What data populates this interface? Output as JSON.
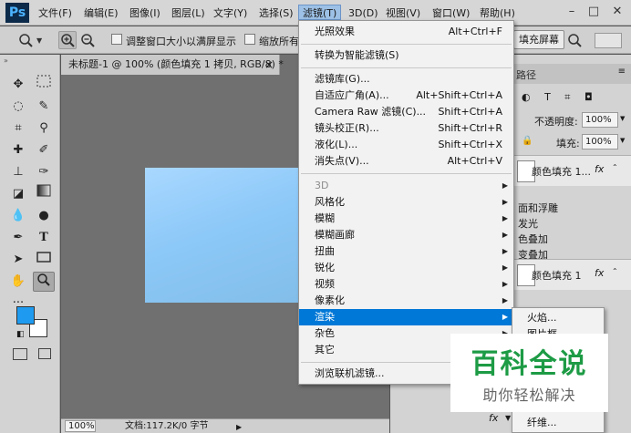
{
  "app": {
    "logo": "Ps",
    "menu": [
      "文件(F)",
      "编辑(E)",
      "图像(I)",
      "图层(L)",
      "文字(Y)",
      "选择(S)",
      "滤镜(T)",
      "3D(D)",
      "视图(V)",
      "窗口(W)",
      "帮助(H)"
    ],
    "active_menu": "滤镜(T)"
  },
  "options_bar": {
    "checkbox1_label": "调整窗口大小以满屏显示",
    "checkbox2_label": "缩放所有",
    "fill_screen_btn": "填充屏幕"
  },
  "document": {
    "tab_title": "未标题-1 @ 100% (颜色填充 1 拷贝, RGB/8) *",
    "tab_close": "×",
    "zoom": "100%",
    "doc_info": "文档:117.2K/0 字节"
  },
  "colors": {
    "foreground": "#1e9bf0",
    "background": "#ffffff",
    "highlight": "#0078d7"
  },
  "filter_menu": {
    "items": [
      {
        "label": "光照效果",
        "shortcut": "Alt+Ctrl+F"
      },
      {
        "label": "转换为智能滤镜(S)",
        "shortcut": ""
      },
      {
        "label": "滤镜库(G)...",
        "shortcut": ""
      },
      {
        "label": "自适应广角(A)...",
        "shortcut": "Alt+Shift+Ctrl+A"
      },
      {
        "label": "Camera Raw 滤镜(C)...",
        "shortcut": "Shift+Ctrl+A"
      },
      {
        "label": "镜头校正(R)...",
        "shortcut": "Shift+Ctrl+R"
      },
      {
        "label": "液化(L)...",
        "shortcut": "Shift+Ctrl+X"
      },
      {
        "label": "消失点(V)...",
        "shortcut": "Alt+Ctrl+V"
      },
      {
        "label": "3D",
        "submenu": true,
        "disabled": true
      },
      {
        "label": "风格化",
        "submenu": true
      },
      {
        "label": "模糊",
        "submenu": true
      },
      {
        "label": "模糊画廊",
        "submenu": true
      },
      {
        "label": "扭曲",
        "submenu": true
      },
      {
        "label": "锐化",
        "submenu": true
      },
      {
        "label": "视频",
        "submenu": true
      },
      {
        "label": "像素化",
        "submenu": true
      },
      {
        "label": "渲染",
        "submenu": true,
        "highlighted": true
      },
      {
        "label": "杂色",
        "submenu": true
      },
      {
        "label": "其它",
        "submenu": true
      },
      {
        "label": "浏览联机滤镜...",
        "shortcut": ""
      }
    ]
  },
  "render_submenu": {
    "items": [
      "火焰...",
      "图片框...",
      "纤维..."
    ]
  },
  "right_panel": {
    "tab_partial": "路径",
    "opacity_label": "不透明度:",
    "opacity_value": "100%",
    "fill_label": "填充:",
    "fill_value": "100%",
    "layer1_name": "颜色填充 1...",
    "layer2_name": "颜色填充 1",
    "fx": "fx",
    "effects": [
      "面和浮雕",
      "发光",
      "色叠加",
      "变叠加"
    ]
  },
  "watermark": {
    "title": "百科全说",
    "subtitle": "助你轻松解决"
  }
}
